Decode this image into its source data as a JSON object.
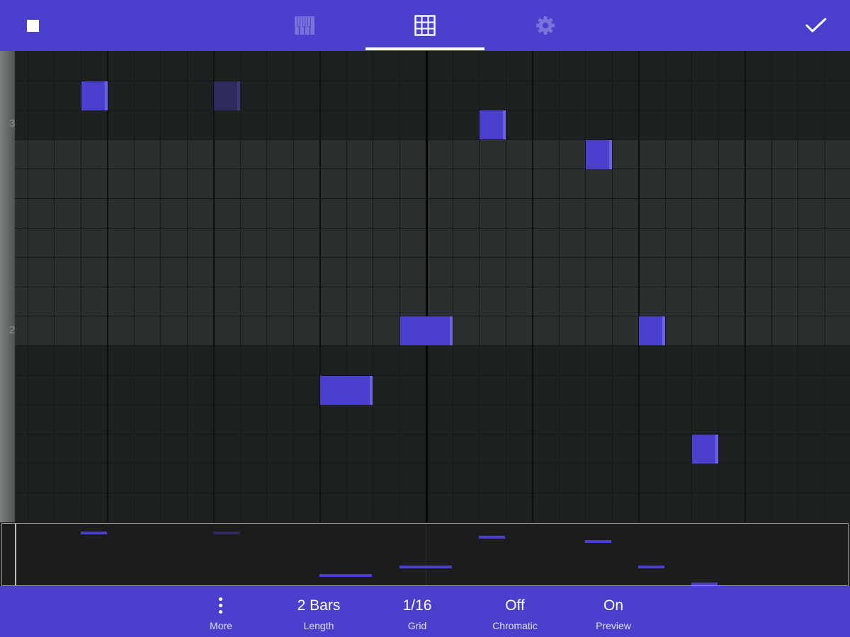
{
  "header": {
    "icons": {
      "stop": "stop-square-icon",
      "keys": "piano-keys-icon",
      "grid": "grid-icon",
      "settings": "gear-icon",
      "done": "checkmark-icon"
    },
    "active_tab": "grid"
  },
  "ruler": {
    "labels": [
      "3",
      "2"
    ]
  },
  "notes": [
    {
      "step": 4,
      "row": 1,
      "length": 1,
      "dim": false
    },
    {
      "step": 9,
      "row": 1,
      "length": 1,
      "dim": true
    },
    {
      "step": 13,
      "row": 11,
      "length": 2,
      "dim": false
    },
    {
      "step": 16,
      "row": 9,
      "length": 2,
      "dim": false
    },
    {
      "step": 19,
      "row": 2,
      "length": 1,
      "dim": false
    },
    {
      "step": 23,
      "row": 3,
      "length": 1,
      "dim": false
    },
    {
      "step": 25,
      "row": 9,
      "length": 1,
      "dim": false
    },
    {
      "step": 27,
      "row": 13,
      "length": 1,
      "dim": false
    }
  ],
  "footer": {
    "more": {
      "label": "More",
      "icon": "vertical-dots-icon"
    },
    "length": {
      "value": "2 Bars",
      "label": "Length"
    },
    "grid": {
      "value": "1/16",
      "label": "Grid"
    },
    "chromatic": {
      "value": "Off",
      "label": "Chromatic"
    },
    "preview": {
      "value": "On",
      "label": "Preview"
    }
  },
  "colors": {
    "accent": "#4b3fcd",
    "note_dim": "#2e2b5c",
    "grid_light": "#2c2f30",
    "grid_dark": "#1e2122"
  }
}
